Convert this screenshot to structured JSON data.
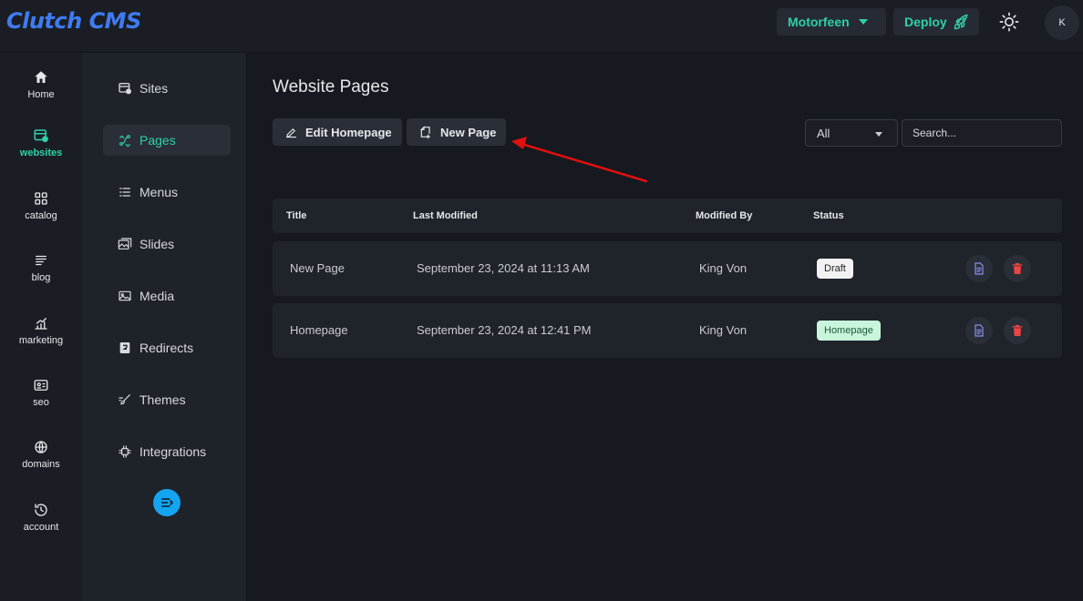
{
  "app": {
    "logo": "Clutch CMS",
    "site_selector": "Motorfeen",
    "deploy_label": "Deploy",
    "avatar_initial": "K",
    "accent_color": "#2fd0a8",
    "brand_color": "#3f7cf2"
  },
  "rail": {
    "items": [
      {
        "label": "Home",
        "icon": "home-icon"
      },
      {
        "label": "websites",
        "icon": "browser-icon",
        "active": true
      },
      {
        "label": "catalog",
        "icon": "grid-icon"
      },
      {
        "label": "blog",
        "icon": "text-lines-icon"
      },
      {
        "label": "marketing",
        "icon": "chart-icon"
      },
      {
        "label": "seo",
        "icon": "id-card-icon"
      },
      {
        "label": "domains",
        "icon": "globe-icon"
      },
      {
        "label": "account",
        "icon": "history-icon"
      }
    ]
  },
  "subnav": {
    "items": [
      {
        "label": "Sites",
        "icon": "browser-icon"
      },
      {
        "label": "Pages",
        "icon": "route-icon",
        "active": true
      },
      {
        "label": "Menus",
        "icon": "list-icon"
      },
      {
        "label": "Slides",
        "icon": "images-icon"
      },
      {
        "label": "Media",
        "icon": "image-icon"
      },
      {
        "label": "Redirects",
        "icon": "redirect-icon"
      },
      {
        "label": "Themes",
        "icon": "brush-icon"
      },
      {
        "label": "Integrations",
        "icon": "chip-icon"
      }
    ]
  },
  "main": {
    "title": "Website Pages",
    "edit_homepage_label": "Edit Homepage",
    "new_page_label": "New Page",
    "filter_value": "All",
    "search_placeholder": "Search...",
    "columns": [
      "Title",
      "Last Modified",
      "Modified By",
      "Status"
    ],
    "rows": [
      {
        "title": "New Page",
        "modified": "September 23, 2024 at 11:13 AM",
        "by": "King Von",
        "status": "Draft"
      },
      {
        "title": "Homepage",
        "modified": "September 23, 2024 at 12:41 PM",
        "by": "King Von",
        "status": "Homepage"
      }
    ]
  }
}
